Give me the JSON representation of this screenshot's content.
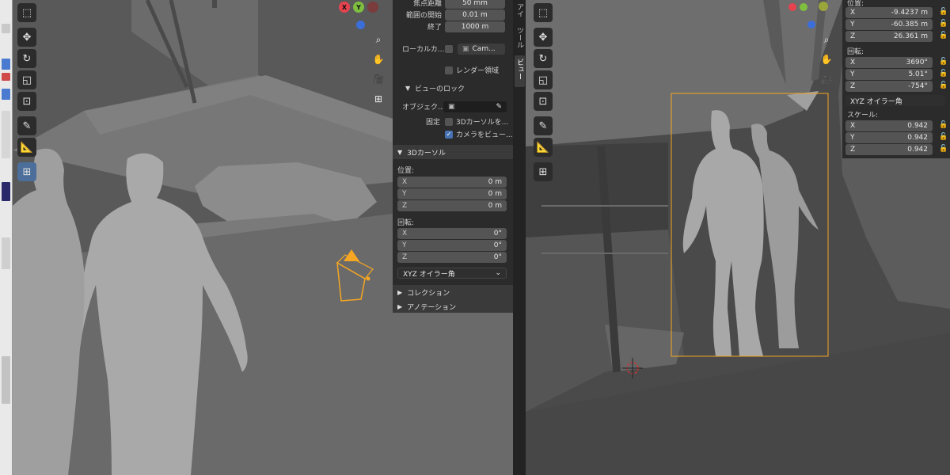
{
  "left_view": {
    "tools": [
      "select-icon",
      "cursor-icon",
      "move-icon",
      "rotate-icon",
      "scale-icon",
      "transform-icon",
      "annotate-icon",
      "measure-icon",
      "add-cube-icon"
    ],
    "gizmo": {
      "x": "X",
      "y": "Y"
    },
    "nav": [
      "zoom-icon",
      "hand-icon",
      "camera-icon",
      "grid-icon"
    ]
  },
  "npanel": {
    "focal_label": "焦点距離",
    "focal_value": "50 mm",
    "clip_start_label": "範囲の開始",
    "clip_start_value": "0.01 m",
    "clip_end_label": "終了",
    "clip_end_value": "1000 m",
    "local_camera_label": "ローカルカ...",
    "local_camera_value": "Cam...",
    "render_region_label": "レンダー領域",
    "view_lock_title": "ビューのロック",
    "object_label": "オブジェク...",
    "lock_label": "固定",
    "lock_cursor": "3Dカーソルを...",
    "camera_to_view": "カメラをビュー...",
    "cursor_section": "3Dカーソル",
    "location_label": "位置:",
    "cursor_location": [
      {
        "axis": "X",
        "value": "0 m"
      },
      {
        "axis": "Y",
        "value": "0 m"
      },
      {
        "axis": "Z",
        "value": "0 m"
      }
    ],
    "rotation_label": "回転:",
    "cursor_rotation": [
      {
        "axis": "X",
        "value": "0°"
      },
      {
        "axis": "Y",
        "value": "0°"
      },
      {
        "axis": "Z",
        "value": "0°"
      }
    ],
    "rotation_mode": "XYZ オイラー角",
    "collection_section": "コレクション",
    "annotation_section": "アノテーション"
  },
  "tabs": [
    "アイ",
    "ツール",
    "ビュー"
  ],
  "right_view": {
    "tools": [
      "select-icon",
      "cursor-icon",
      "move-icon",
      "rotate-icon",
      "scale-icon",
      "transform-icon",
      "annotate-icon",
      "measure-icon",
      "add-cube-icon"
    ]
  },
  "transform": {
    "location_label": "位置:",
    "location": [
      {
        "axis": "X",
        "value": "-9.4237 m"
      },
      {
        "axis": "Y",
        "value": "-60.385 m"
      },
      {
        "axis": "Z",
        "value": "26.361 m"
      }
    ],
    "rotation_label": "回転:",
    "rotation": [
      {
        "axis": "X",
        "value": "3690°"
      },
      {
        "axis": "Y",
        "value": "5.01°"
      },
      {
        "axis": "Z",
        "value": "-754°"
      }
    ],
    "rotation_mode": "XYZ オイラー角",
    "scale_label": "スケール:",
    "scale": [
      {
        "axis": "X",
        "value": "0.942"
      },
      {
        "axis": "Y",
        "value": "0.942"
      },
      {
        "axis": "Z",
        "value": "0.942"
      }
    ]
  },
  "colors": {
    "accent": "#4772b3",
    "selection": "#f5a623",
    "axis_x": "#e6434f",
    "axis_y": "#7fbf3f",
    "axis_z": "#3b6ed8"
  }
}
